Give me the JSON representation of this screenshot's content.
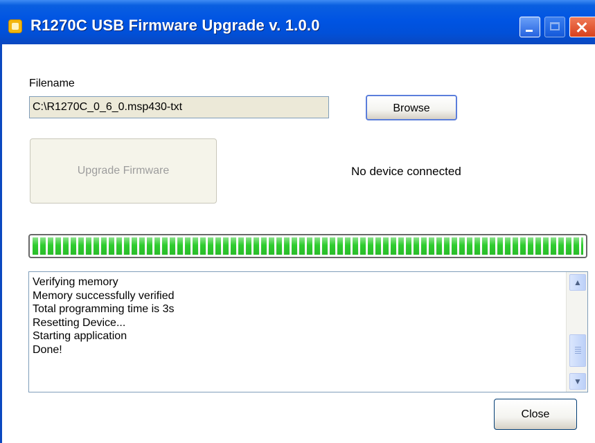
{
  "window": {
    "title": "R1270C USB Firmware Upgrade v. 1.0.0"
  },
  "form": {
    "filename_label": "Filename",
    "filename_value": "C:\\R1270C_0_6_0.msp430-txt",
    "browse_label": "Browse",
    "upgrade_label": "Upgrade Firmware",
    "status_text": "No device connected"
  },
  "progress": {
    "value_percent": 100,
    "color": "#2ecc2e"
  },
  "log": {
    "lines": [
      "Verifying memory",
      "Memory successfully verified",
      "Total programming time is 3s",
      "Resetting Device...",
      "Starting application",
      "Done!"
    ]
  },
  "footer": {
    "close_label": "Close"
  },
  "icons": {
    "app": "app-icon",
    "minimize": "minimize-icon",
    "maximize": "maximize-icon",
    "close": "close-icon",
    "scroll_up": "chevron-up-icon",
    "scroll_down": "chevron-down-icon"
  }
}
